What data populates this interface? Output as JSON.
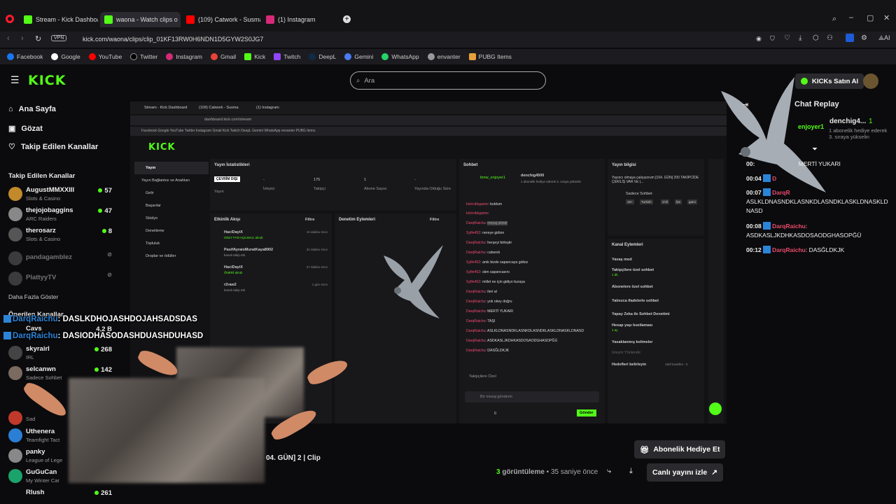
{
  "browser": {
    "tabs": [
      {
        "label": "Stream - Kick Dashboard",
        "color": "#53fc18"
      },
      {
        "label": "waona - Watch clips o",
        "color": "#53fc18"
      },
      {
        "label": "(109) Catwork - Susma (Fr",
        "color": "#ff0000"
      },
      {
        "label": "(1) Instagram",
        "color": "#d62976"
      }
    ],
    "url": "kick.com/waona/clips/clip_01KF13RW0H6NDN1D5GYW2S0JG7",
    "vpn": "VPN",
    "ai_label": "AI",
    "bookmarks": [
      "Facebook",
      "Google",
      "YouTube",
      "Twitter",
      "Instagram",
      "Gmail",
      "Kick",
      "Twitch",
      "DeepL",
      "Gemini",
      "WhatsApp",
      "envanter",
      "PUBG Items"
    ]
  },
  "kick": {
    "logo": "KICK",
    "search_placeholder": "Ara",
    "buy_kicks": "KICKs Satın Al",
    "nav": [
      {
        "label": "Ana Sayfa",
        "icon": "home-icon"
      },
      {
        "label": "Gözat",
        "icon": "browse-icon"
      },
      {
        "label": "Takip Edilen Kanallar",
        "icon": "heart-icon"
      }
    ],
    "followed_title": "Takip Edilen Kanallar",
    "followed": [
      {
        "name": "AugustMMXXIII",
        "category": "Slots & Casino",
        "viewers": "57",
        "live": true
      },
      {
        "name": "thejojobaggins",
        "category": "ARC Raiders",
        "viewers": "47",
        "live": true
      },
      {
        "name": "therosarz",
        "category": "Slots & Casino",
        "viewers": "8",
        "live": true
      },
      {
        "name": "pandagamblez",
        "category": "",
        "viewers": "",
        "live": false
      },
      {
        "name": "PlattyyTV",
        "category": "",
        "viewers": "",
        "live": false
      }
    ],
    "show_more": "Daha Fazla Göster",
    "recommended_title": "Önerilen Kanallar",
    "recommended": [
      {
        "name": "Cavs",
        "category": "",
        "viewers": "4,2 B"
      },
      {
        "name": "skyrairl",
        "category": "IRL",
        "viewers": "268"
      },
      {
        "name": "selcanwn",
        "category": "Sadece Sohbet",
        "viewers": "142"
      },
      {
        "name": "bufa",
        "category": "",
        "viewers": ""
      },
      {
        "name": "",
        "category": "Sad",
        "viewers": ""
      },
      {
        "name": "Uthenera",
        "category": "Teamfight Tact",
        "viewers": ""
      },
      {
        "name": "panky",
        "category": "League of Lege",
        "viewers": ""
      },
      {
        "name": "GuGuCan",
        "category": "My Winter Car",
        "viewers": ""
      },
      {
        "name": "Rlush",
        "category": "",
        "viewers": "261"
      }
    ],
    "chat_replay_title": "Chat Replay",
    "gift": {
      "user": "denchig4...",
      "count": "1",
      "text": "1 abonelik hediye ederek 3. sıraya yükselin",
      "mention": "enjoyer1"
    },
    "replay": [
      {
        "time": "00:",
        "user": "",
        "msg": "MERTİ YUKARI"
      },
      {
        "time": "00:04",
        "user": "D",
        "msg": ""
      },
      {
        "time": "00:07",
        "user": "DarqR",
        "msg": "ASLKLDNASNDKLASNKDLASNDKLASKLDNASKLDNASD"
      },
      {
        "time": "00:08",
        "user": "DarqRaichu",
        "msg": "ASDKASLJKDHKASDOSAODGHASOPĞÜ"
      },
      {
        "time": "00:12",
        "user": "DarqRaichu",
        "msg": "DASĞLDKJK"
      }
    ],
    "clip_title_fragment": "04. GÜN]  2 | Clip",
    "views": "3",
    "views_label": "görüntüleme",
    "ago": "35 saniye önce",
    "gift_sub_btn": "Abonelik Hediye Et",
    "watch_live_btn": "Canlı yayını izle",
    "overlay_lines": [
      {
        "user": "DarqRaichu",
        "msg": ": DASLKDHOJASHDOJAHSADSDAS"
      },
      {
        "user": "DarqRaichu",
        "msg": ": DASIODHASODASHDUASHDUHASD"
      }
    ]
  },
  "inner": {
    "tabs": [
      "Stream - Kick Dashboard",
      "(109) Catwork - Susma",
      "(1) Instagram"
    ],
    "url": "dashboard.kick.com/stream",
    "menu": [
      "Yayın",
      "Yayın Bağlantısı ve Anahtarı",
      "Gelir",
      "Başarılar",
      "Stüdyo",
      "Denetleme",
      "Topluluk",
      "Droplar ve ödüller"
    ],
    "stats_title": "Yayın İstatistikleri",
    "stats": [
      {
        "value": "ÇEVRİM DIŞI",
        "label": "Yayın"
      },
      {
        "value": "-",
        "label": "İzleyici"
      },
      {
        "value": "175",
        "label": "Takipçi"
      },
      {
        "value": "1",
        "label": "Abone Sayısı"
      },
      {
        "value": "-",
        "label": "Yayında Olduğu Süre"
      }
    ],
    "activity_title": "Etkinlik Akışı",
    "filter": "Filtre",
    "activity": [
      {
        "name": "HaciDayiX",
        "sub": "ONLY FAN AÇILMALI alındı",
        "time": "15 dakika önce"
      },
      {
        "name": "PasifAyraisMuratKaya8902",
        "sub": "kanalı takip etti",
        "time": "32 dakika önce"
      },
      {
        "name": "HaciDayiX",
        "sub": "ÖNERİ alındı",
        "time": "37 dakika önce"
      },
      {
        "name": "r2raw2",
        "sub": "kanalı takip etti",
        "time": "1 gün önce"
      }
    ],
    "mod_title": "Denetim Eylemleri",
    "chat_title": "Sohbet",
    "chat_top": {
      "user1": "bmw_enjoyer1",
      "user2": "denchig4500",
      "note": "1 abonelik hediye ederek 3. sıraya yükselin"
    },
    "chat": [
      {
        "user": "kivircikkgame",
        "msg": "buldum"
      },
      {
        "user": "kivircikkgame",
        "msg": ""
      },
      {
        "user": "DarqRaichu",
        "msg": "mesaj silindi"
      },
      {
        "user": "Sylfe452",
        "msg": "nereye gidion"
      },
      {
        "user": "DarqRaichu",
        "msg": "herşeyi birleştir"
      },
      {
        "user": "DarqRaichu",
        "msg": "catwork"
      },
      {
        "user": "Sylfe452",
        "msg": "amk bizde sapancaya gidioz"
      },
      {
        "user": "Sylfe452",
        "msg": "skm sapancasını"
      },
      {
        "user": "Sylfe452",
        "msg": "millet ne için gidiyo buraya"
      },
      {
        "user": "DarqRaichu",
        "msg": "ileri al"
      },
      {
        "user": "DarqRaichu",
        "msg": "yok okey doğru"
      },
      {
        "user": "DarqRaichu",
        "msg": "MERTİ YUKARI"
      },
      {
        "user": "DarqRaichu",
        "msg": "TAŞI"
      },
      {
        "user": "DarqRaichu",
        "msg": "ASLKLDNASNDKLASNKDLASNDKLASKLDNASKLDNASD"
      },
      {
        "user": "DarqRaichu",
        "msg": "ASDKASLJKDHKASDOSAODGHASOPĞÜ"
      },
      {
        "user": "DarqRaichu",
        "msg": "DASĞLDKJK"
      }
    ],
    "followers_only": "Takipçilere Özel",
    "input_placeholder": "Bir mesaj gönderin",
    "send": "Gönder",
    "points": "0",
    "stream_info_title": "Yayın bilgisi",
    "stream_info_text": "Yayıncı olmaya çalışıyorum [104. GÜN] 200 TAKİPCİDE ÇEKİLİŞ VAR !dc |...",
    "stream_category": "Sadece Sohbet",
    "stream_tags": [
      "18+",
      "Turkish",
      "chill",
      "fps",
      "gami"
    ],
    "channel_actions_title": "Kanal Eylemleri",
    "channel_actions": [
      "Yavaş mod",
      "Takipçilere özel sohbet",
      "Abonelere özel sohbet",
      "Yalnızca ifadelerle sohbet",
      "Yapay Zeka ile Sohbet Denetimi",
      "Hesap yaşı kısıtlaması",
      "Yasaklanmış kelimeler",
      "İzleyici Yönlendir",
      "Hedefleri belirleyin"
    ],
    "follower_sub": "1 dk.",
    "age_sub": "1 ay",
    "goals_badge": "Aktif hedefler : 0"
  }
}
